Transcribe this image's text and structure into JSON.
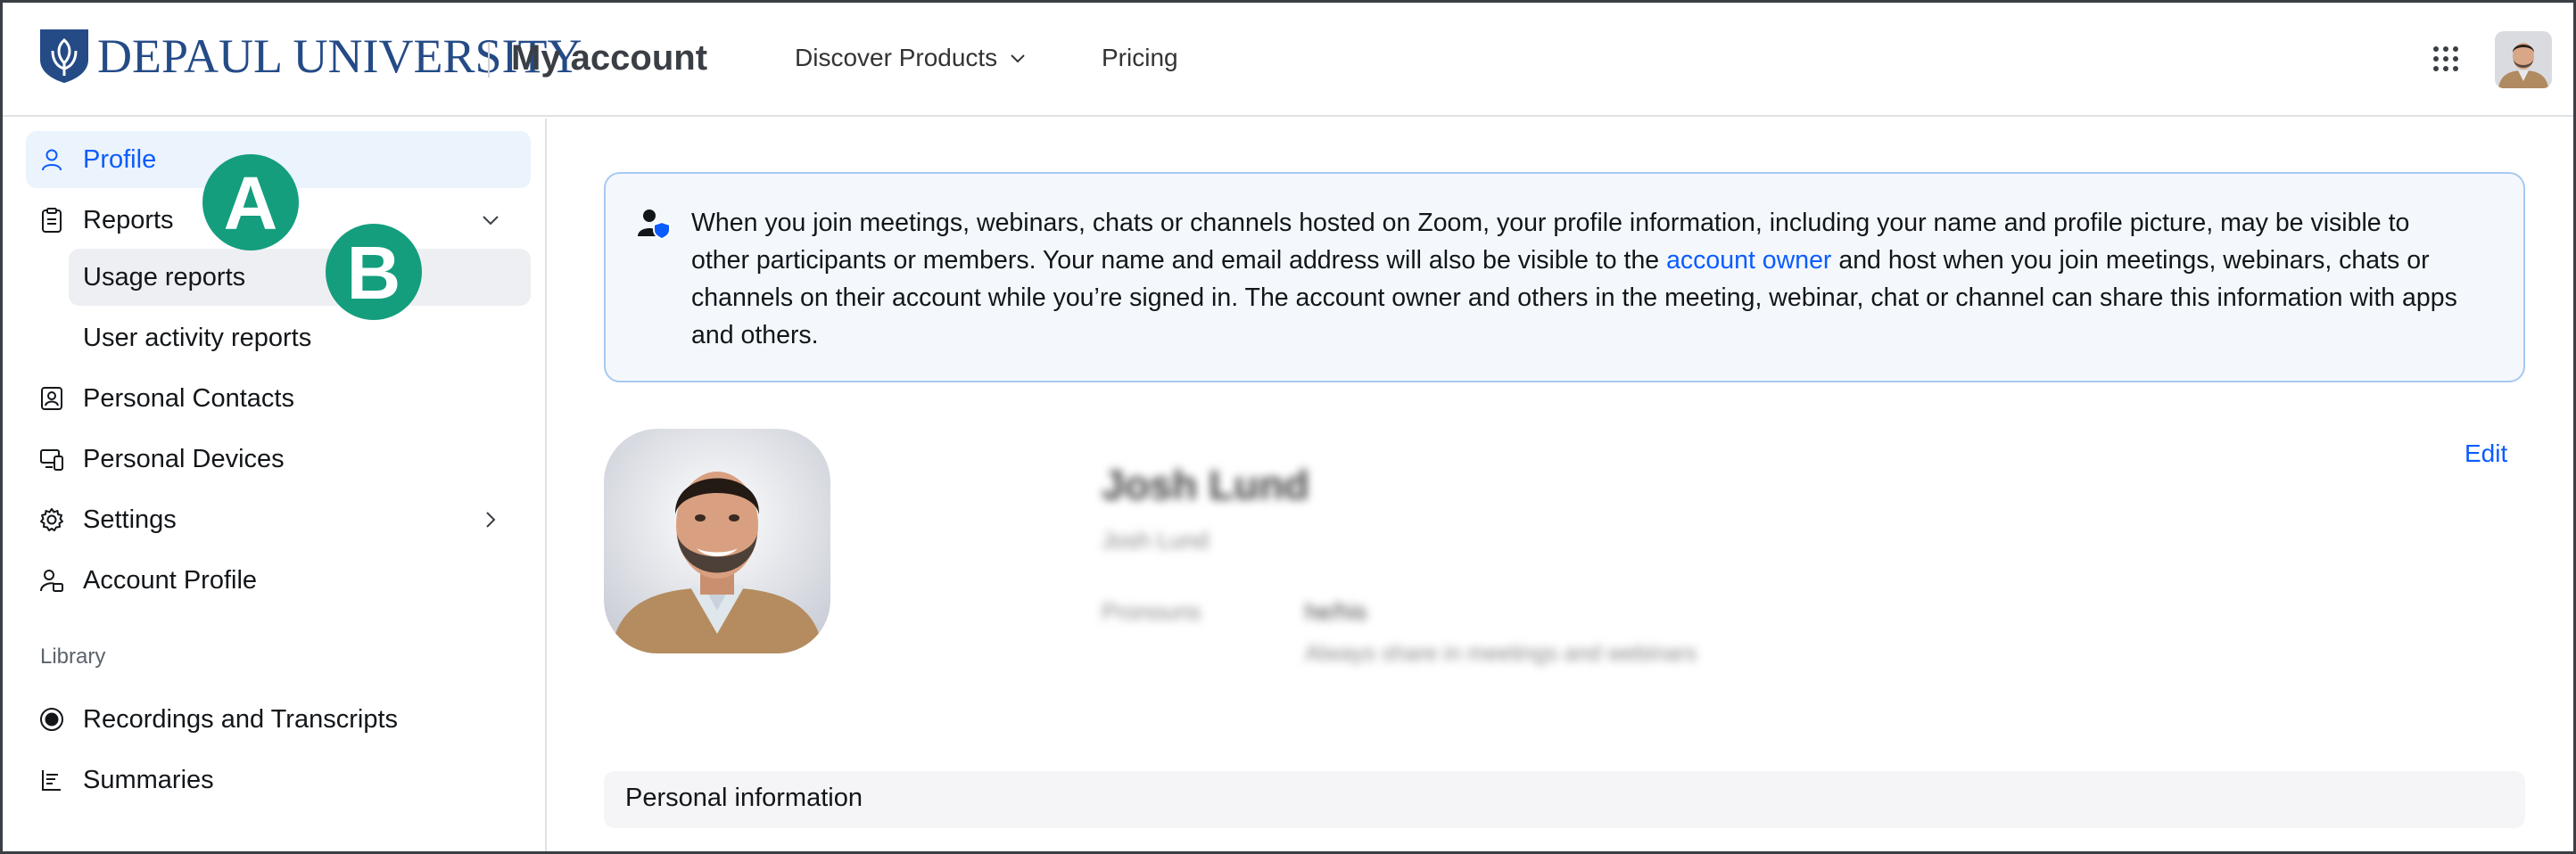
{
  "header": {
    "logo_text": "DEPAUL UNIVERSITY",
    "app_title": "My account",
    "nav": {
      "discover_label": "Discover Products",
      "pricing_label": "Pricing"
    }
  },
  "sidebar": {
    "items": [
      {
        "label": "Profile"
      },
      {
        "label": "Reports"
      },
      {
        "label": "Usage reports"
      },
      {
        "label": "User activity reports"
      },
      {
        "label": "Personal Contacts"
      },
      {
        "label": "Personal Devices"
      },
      {
        "label": "Settings"
      },
      {
        "label": "Account Profile"
      }
    ],
    "library_label": "Library",
    "library_items": [
      {
        "label": "Recordings and Transcripts"
      },
      {
        "label": "Summaries"
      }
    ]
  },
  "badges": {
    "a": "A",
    "b": "B"
  },
  "notice": {
    "text_before_link": "When you join meetings, webinars, chats or channels hosted on Zoom, your profile information, including your name and profile picture, may be visible to other participants or members. Your name and email address will also be visible to the ",
    "link_text": "account owner",
    "text_after_link": " and host when you join meetings, webinars, chats or channels on their account while you’re signed in. The account owner and others in the meeting, webinar, chat or channel can share this information with apps and others."
  },
  "profile": {
    "name": "Josh Lund",
    "display_name": "Josh Lund",
    "pronouns_label": "Pronouns",
    "pronouns_value": "he/his",
    "pronouns_note": "Always share in meetings and webinars",
    "edit_label": "Edit"
  },
  "sections": {
    "personal_info_title": "Personal information"
  },
  "colors": {
    "accent": "#0b5cff",
    "badge": "#149e7e",
    "logo": "#244b86"
  }
}
